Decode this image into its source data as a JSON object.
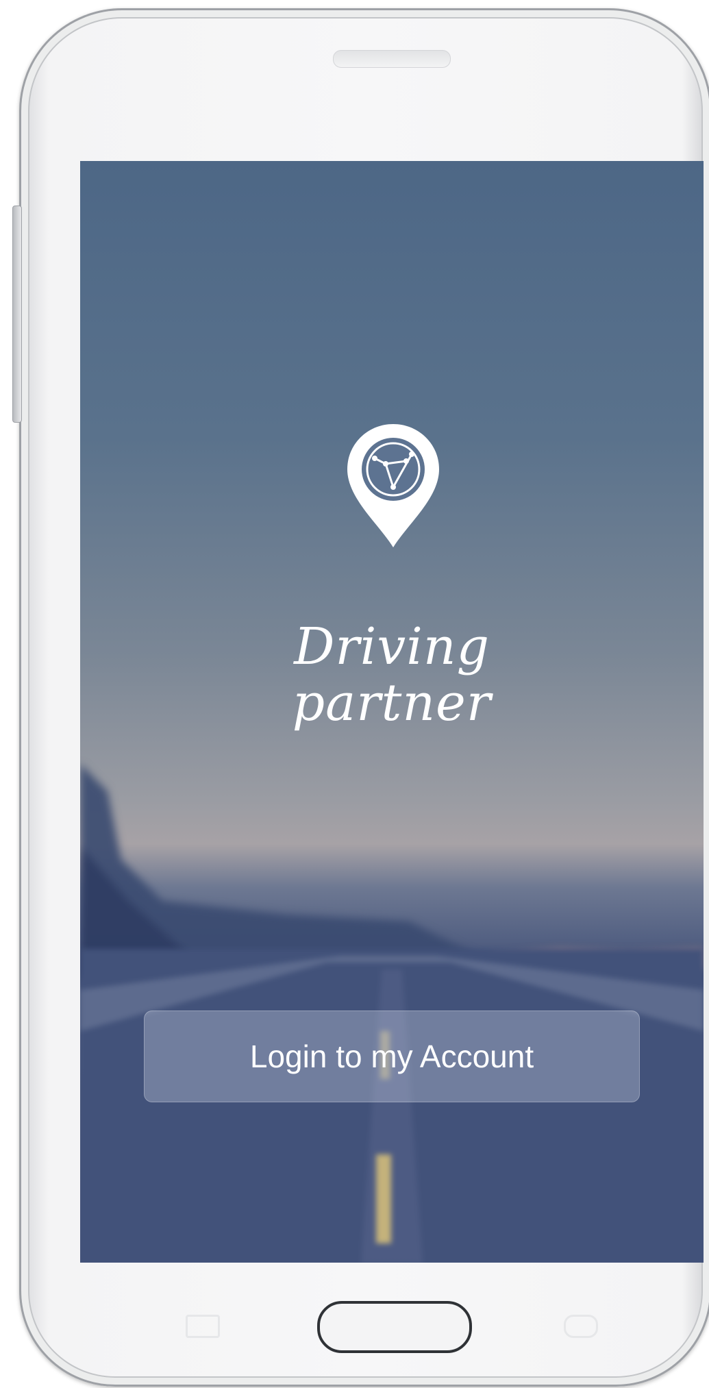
{
  "app": {
    "title_line1": "Driving",
    "title_line2": "partner",
    "login_label": "Login to my Account",
    "logo_icon": "map-pin-icon"
  },
  "device": {
    "home_button": "home-button",
    "menu_key": "menu-key-icon",
    "back_key": "back-key-icon"
  },
  "colors": {
    "sky_top": "#4d6786",
    "sky_horizon": "#a7a2a6",
    "road": "#45557a",
    "text": "#ffffff"
  }
}
